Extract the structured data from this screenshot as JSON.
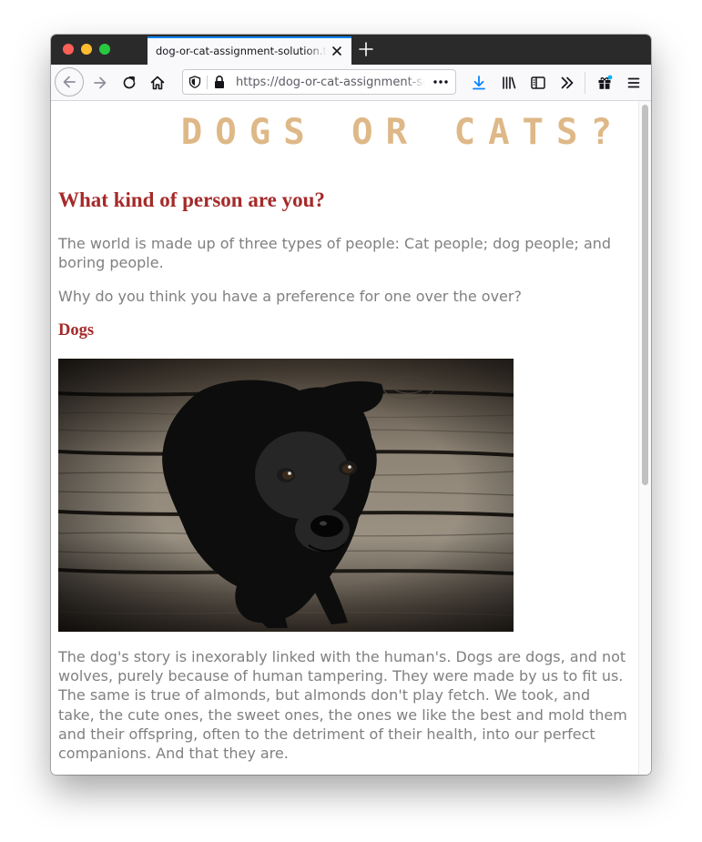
{
  "browser": {
    "tab_title": "dog-or-cat-assignment-solution.thimble",
    "url": "https://dog-or-cat-assignment-solution.thimble"
  },
  "page": {
    "site_title": "DOGS OR CATS?",
    "heading": "What kind of person are you?",
    "intro_paragraph_1": "The world is made up of three types of people: Cat people; dog people; and boring people.",
    "intro_paragraph_2": "Why do you think you have a preference for one over the over?",
    "dogs_heading": "Dogs",
    "dogs_paragraph": "The dog's story is inexorably linked with the human's. Dogs are dogs, and not wolves, purely because of human tampering. They were made by us to fit us. The same is true of almonds, but almonds don't play fetch. We took, and take, the cute ones, the sweet ones, the ones we like the best and mold them and their offspring, often to the detriment of their health, into our perfect companions. And that they are."
  },
  "colors": {
    "site_title": "#deb887",
    "headings": "#a52a2a",
    "body_text": "#808080",
    "tab_accent": "#0a84ff",
    "download_icon": "#0a84ff"
  },
  "icons": {
    "tab": [
      "close-icon",
      "plus-icon"
    ],
    "toolbar": [
      "back-arrow-icon",
      "forward-arrow-icon",
      "reload-icon",
      "home-icon",
      "shield-icon",
      "lock-icon",
      "more-dots-icon",
      "download-arrow-icon",
      "library-icon",
      "sidebar-icon",
      "chevron-double-right-icon",
      "gift-icon",
      "hamburger-menu-icon"
    ]
  },
  "images": {
    "dog_photo": "black-labrador-puppy-on-wooden-planks"
  }
}
